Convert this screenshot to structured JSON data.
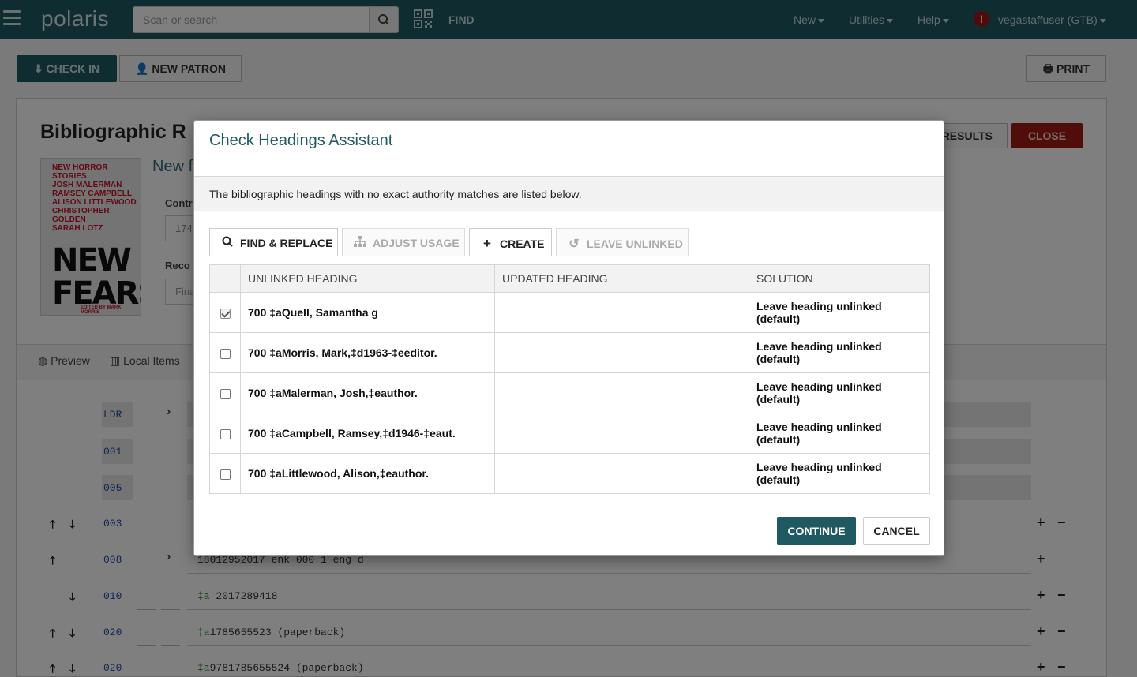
{
  "header": {
    "logo": "polaris",
    "search_placeholder": "Scan or search",
    "find_label": "FIND",
    "menu": [
      {
        "label": "New"
      },
      {
        "label": "Utilities"
      },
      {
        "label": "Help"
      }
    ],
    "user": "vegastaffuser (GTB)",
    "alert_glyph": "!"
  },
  "toolbar": {
    "checkin_label": "CHECK IN",
    "newpatron_label": "NEW PATRON",
    "print_label": "PRINT"
  },
  "record": {
    "title": "Bibliographic R",
    "results_label": "RESULTS",
    "close_label": "CLOSE",
    "subtitle": "New f",
    "contr_label": "Contr",
    "contr_value": "174",
    "reco_label": "Reco",
    "reco_placeholder": "Fina",
    "cover": {
      "top_lines": [
        "NEW HORROR STORIES",
        "JOSH MALERMAN",
        "RAMSEY CAMPBELL",
        "ALISON LITTLEWOOD",
        "CHRISTOPHER GOLDEN",
        "SARAH LOTZ"
      ],
      "title_line1": "NEW",
      "title_line2": "FEARS",
      "editor": "EDITED BY MARK MORRIS"
    },
    "tabs": [
      {
        "label": "Preview"
      },
      {
        "label": "Local Items"
      }
    ],
    "marc": [
      {
        "tag": "LDR",
        "text": ""
      },
      {
        "tag": "001",
        "text": ""
      },
      {
        "tag": "005",
        "text": ""
      },
      {
        "tag": "003",
        "text": ""
      },
      {
        "tag": "008",
        "text": "18012952017    enk           000 1 eng d"
      },
      {
        "tag": "010",
        "sub": "‡a",
        "text": "  2017289418"
      },
      {
        "tag": "020",
        "sub": "‡a",
        "text": "1785655523 (paperback)"
      },
      {
        "tag": "020",
        "sub": "‡a",
        "text": "9781785655524 (paperback)"
      }
    ]
  },
  "modal": {
    "title": "Check Headings Assistant",
    "info": "The bibliographic headings with no exact authority matches are listed below.",
    "tools": {
      "find_replace": "FIND & REPLACE",
      "adjust_usage": "ADJUST USAGE",
      "create": "CREATE",
      "leave_unlinked": "LEAVE UNLINKED"
    },
    "columns": {
      "unlinked": "UNLINKED HEADING",
      "updated": "UPDATED HEADING",
      "solution": "SOLUTION"
    },
    "rows": [
      {
        "checked": true,
        "unlinked": "700 ‡aQuell, Samantha g",
        "updated": "",
        "solution": "Leave heading unlinked (default)"
      },
      {
        "checked": false,
        "unlinked": "700 ‡aMorris, Mark,‡d1963-‡eeditor.",
        "updated": "",
        "solution": "Leave heading unlinked (default)"
      },
      {
        "checked": false,
        "unlinked": "700 ‡aMalerman, Josh,‡eauthor.",
        "updated": "",
        "solution": "Leave heading unlinked (default)"
      },
      {
        "checked": false,
        "unlinked": "700 ‡aCampbell, Ramsey,‡d1946-‡eaut.",
        "updated": "",
        "solution": "Leave heading unlinked (default)"
      },
      {
        "checked": false,
        "unlinked": "700 ‡aLittlewood, Alison,‡eauthor.",
        "updated": "",
        "solution": "Leave heading unlinked (default)"
      }
    ],
    "continue_label": "CONTINUE",
    "cancel_label": "CANCEL"
  },
  "colors": {
    "brand": "#1f5a63",
    "close_red": "#a31b12"
  }
}
